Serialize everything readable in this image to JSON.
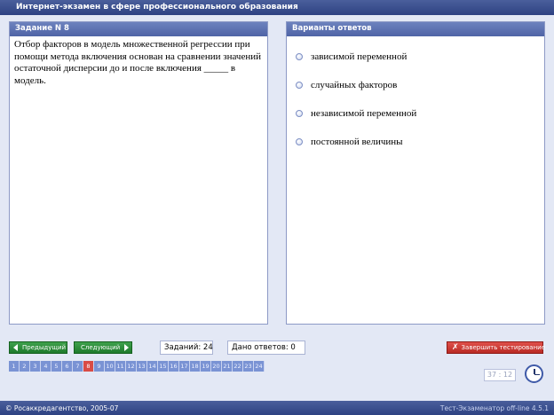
{
  "app": {
    "title": "Интернет-экзамен в сфере профессионального образования"
  },
  "question": {
    "header": "Задание N 8",
    "text": "Отбор факторов в модель множественной регрессии при помощи метода включения основан на сравнении значений остаточной дисперсии до и после включения _____ в модель."
  },
  "answers": {
    "header": "Варианты ответов",
    "options": [
      "зависимой переменной",
      "случайных факторов",
      "независимой переменной",
      "постоянной величины"
    ]
  },
  "nav": {
    "prev_label": "Предыдущий",
    "next_label": "Следующий",
    "tasks_label": "Заданий: 24",
    "answered_label": "Дано ответов: 0",
    "finish_label": "Завершить тестирование"
  },
  "question_numbers": [
    "1",
    "2",
    "3",
    "4",
    "5",
    "6",
    "7",
    "8",
    "9",
    "10",
    "11",
    "12",
    "13",
    "14",
    "15",
    "16",
    "17",
    "18",
    "19",
    "20",
    "21",
    "22",
    "23",
    "24"
  ],
  "current_question": 8,
  "timer": "37 : 12",
  "footer": {
    "copyright": "© Росаккредагентство, 2005-07",
    "version": "Тест-Экзаменатор off-line 4.5.1"
  },
  "colors": {
    "accent": "#2e4282",
    "nav_green": "#1f7a2c",
    "finish_red": "#b92a24",
    "current_question": "#d94b45"
  }
}
